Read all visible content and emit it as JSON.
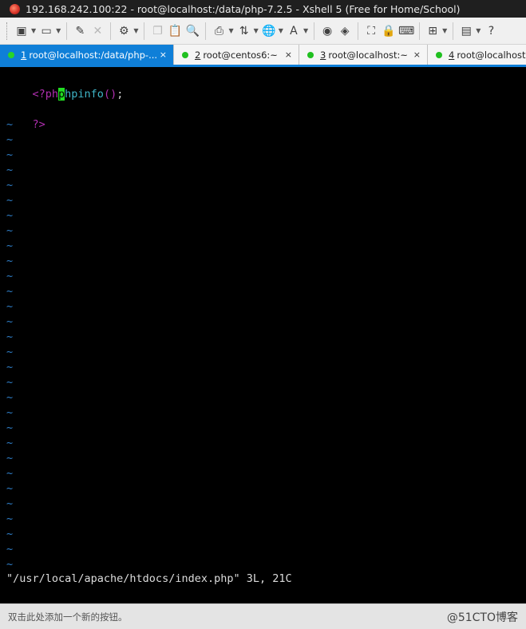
{
  "window": {
    "title": "192.168.242.100:22 - root@localhost:/data/php-7.2.5 - Xshell 5 (Free for Home/School)",
    "app_icon": "xshell-icon"
  },
  "toolbar": {
    "buttons": [
      {
        "name": "new-session-icon",
        "glyph": "▣",
        "caret": true
      },
      {
        "name": "open-folder-icon",
        "glyph": "▭",
        "caret": true
      },
      {
        "name": "reconnect-icon",
        "glyph": "✎",
        "caret": false
      },
      {
        "name": "disconnect-icon",
        "glyph": "✕",
        "caret": false,
        "disabled": true
      },
      {
        "name": "properties-icon",
        "glyph": "⚙",
        "caret": true
      },
      {
        "name": "copy-icon",
        "glyph": "❐",
        "caret": false,
        "disabled": true
      },
      {
        "name": "paste-icon",
        "glyph": "📋",
        "caret": false
      },
      {
        "name": "find-icon",
        "glyph": "🔍",
        "caret": false
      },
      {
        "name": "print-icon",
        "glyph": "⎙",
        "caret": true
      },
      {
        "name": "transfer-icon",
        "glyph": "⇅",
        "caret": true
      },
      {
        "name": "globe-icon",
        "glyph": "🌐",
        "caret": true
      },
      {
        "name": "font-icon",
        "glyph": "A",
        "caret": true
      },
      {
        "name": "xftp-icon",
        "glyph": "◉",
        "caret": false
      },
      {
        "name": "script-icon",
        "glyph": "◈",
        "caret": false
      },
      {
        "name": "fullscreen-icon",
        "glyph": "⛶",
        "caret": false
      },
      {
        "name": "lock-icon",
        "glyph": "🔒",
        "caret": false
      },
      {
        "name": "keyboard-icon",
        "glyph": "⌨",
        "caret": false
      },
      {
        "name": "add-tab-icon",
        "glyph": "⊞",
        "caret": true
      },
      {
        "name": "layout-icon",
        "glyph": "▤",
        "caret": true
      },
      {
        "name": "help-icon",
        "glyph": "?",
        "caret": false
      }
    ]
  },
  "tabs": [
    {
      "num": "1",
      "label": "root@localhost:/data/php-...",
      "active": true,
      "width": 218
    },
    {
      "num": "2",
      "label": "root@centos6:~",
      "active": false,
      "width": 157
    },
    {
      "num": "3",
      "label": "root@localhost:~",
      "active": false,
      "width": 161
    },
    {
      "num": "4",
      "label": "root@localhost:~",
      "active": false,
      "width": 130
    }
  ],
  "terminal": {
    "line1": "<?php",
    "line2_indent": "        ",
    "line2_cursor": "p",
    "line2_fn": "hpinfo",
    "line2_paren": "()",
    "line2_semi": ";",
    "line3": "?>",
    "tilde": "~",
    "tilde_count": 30,
    "status": "\"/usr/local/apache/htdocs/index.php\" 3L, 21C"
  },
  "statusbar": {
    "hint": "双击此处添加一个新的按钮。",
    "watermark": "@51CTO博客"
  },
  "colors": {
    "tab_active": "#0f7fd8",
    "cursor": "#22dd22",
    "keyword": "#b02fb0",
    "function": "#3fb6c8",
    "tilde": "#2f7ec8"
  }
}
